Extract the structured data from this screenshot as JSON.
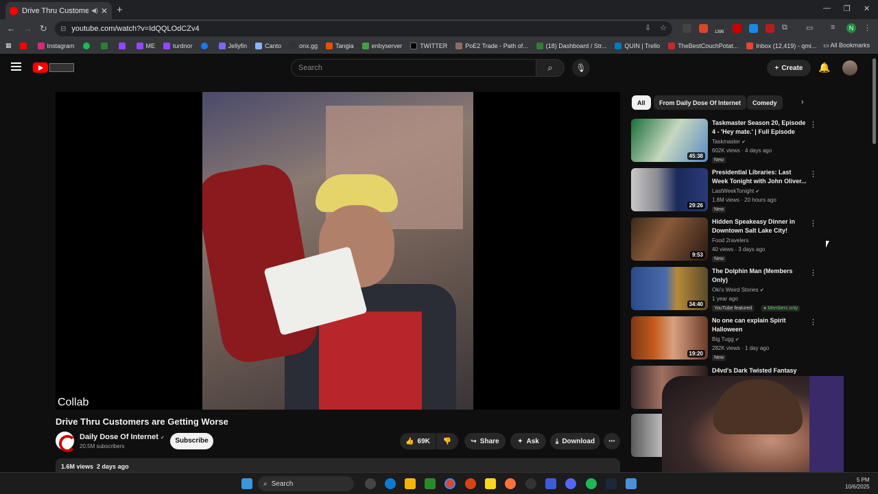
{
  "browser": {
    "tab_title": "Drive Thru Customers are G",
    "url": "youtube.com/watch?v=IdQQLOdCZv4",
    "profile_initial": "N",
    "bookmarks": [
      "Instagram",
      "ME",
      "turdnor",
      "Jellyfin",
      "Canto",
      "onx.gg",
      "Tangia",
      "enbyserver",
      "TWITTER",
      "PoE2 Trade - Path of...",
      "(18) Dashboard / Str...",
      "QUIN | Trello",
      "TheBestCouchPotat...",
      "Inbox (12,419) - qmi..."
    ],
    "all_bookmarks": "All Bookmarks",
    "ext_badge": "1395"
  },
  "header": {
    "search_placeholder": "Search",
    "create_label": "Create"
  },
  "video": {
    "overlay_label": "Collab",
    "title": "Drive Thru Customers are Getting Worse",
    "channel": "Daily Dose Of Internet",
    "subscribers": "20.5M subscribers",
    "subscribe_label": "Subscribe",
    "likes": "69K",
    "share_label": "Share",
    "ask_label": "Ask",
    "download_label": "Download",
    "views": "1.6M views",
    "age": "2 days ago"
  },
  "chips": [
    "All",
    "From Daily Dose Of Internet",
    "Comedy"
  ],
  "recommendations": [
    {
      "title": "Taskmaster Season 20, Episode 4 - 'Hey mate.' | Full Episode",
      "channel": "Taskmaster",
      "meta": "602K views · 4 days ago",
      "duration": "45:38",
      "badge": "New"
    },
    {
      "title": "Presidential Libraries: Last Week Tonight with John Oliver...",
      "channel": "LastWeekTonight",
      "meta": "1.8M views · 20 hours ago",
      "duration": "29:26",
      "badge": "New"
    },
    {
      "title": "Hidden Speakeasy Dinner in Downtown Salt Lake City!",
      "channel": "Food 2ravelers",
      "meta": "40 views · 3 days ago",
      "duration": "9:53",
      "badge": "New"
    },
    {
      "title": "The Dolphin Man (Members Only)",
      "channel": "Oki's Weird Stories",
      "meta": "1 year ago",
      "duration": "34:40",
      "badge": "YouTube featured",
      "badge2": "Members only"
    },
    {
      "title": "No one can explain Spirit Halloween",
      "channel": "Big Tugg",
      "meta": "282K views · 1 day ago",
      "duration": "19:20",
      "badge": "New"
    },
    {
      "title": "D4vd's Dark Twisted Fantasy",
      "channel": "",
      "meta": "",
      "duration": "",
      "badge": ""
    }
  ],
  "taskbar": {
    "search_label": "Search",
    "clock_time": "5 PM",
    "clock_date": "10/6/2025"
  },
  "colors": {
    "yt_red": "#ff0000",
    "bg": "#0f0f0f",
    "chip_active": "#f1f1f1"
  }
}
